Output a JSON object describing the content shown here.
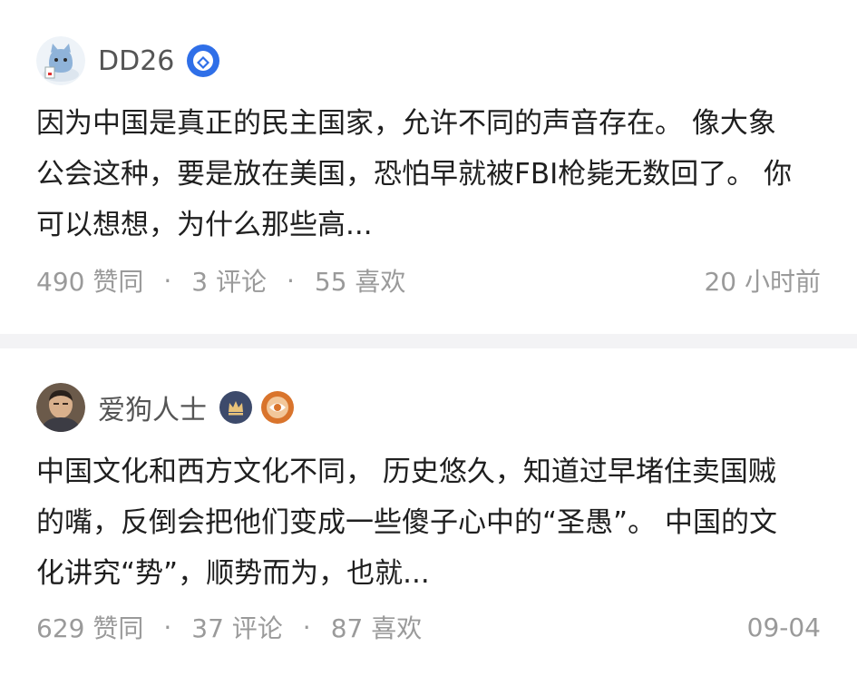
{
  "posts": [
    {
      "username": "DD26",
      "content": "因为中国是真正的民主国家，允许不同的声音存在。 像大象公会这种，要是放在美国，恐怕早就被FBI枪毙无数回了。 你可以想想，为什么那些高...",
      "likes": "490 赞同",
      "comments": "3 评论",
      "favs": "55 喜欢",
      "time": "20 小时前",
      "avatar_icon": "cat-avatar-icon",
      "badges": [
        "blue-verified-badge-icon"
      ]
    },
    {
      "username": "爱狗人士",
      "content": "中国文化和西方文化不同， 历史悠久，知道过早堵住卖国贼的嘴，反倒会把他们变成一些傻子心中的“圣愚”。 中国的文化讲究“势”，顺势而为，也就...",
      "likes": "629 赞同",
      "comments": "37 评论",
      "favs": "87 喜欢",
      "time": "09-04",
      "avatar_icon": "man-avatar-icon",
      "badges": [
        "crown-badge-icon",
        "eye-badge-icon"
      ]
    }
  ],
  "separator_dot": "·",
  "colors": {
    "blue_badge": "#2f6fe8",
    "crown_badge": "#3d4a6b",
    "eye_badge": "#d9742c",
    "meta_text": "#9a9a9a"
  }
}
